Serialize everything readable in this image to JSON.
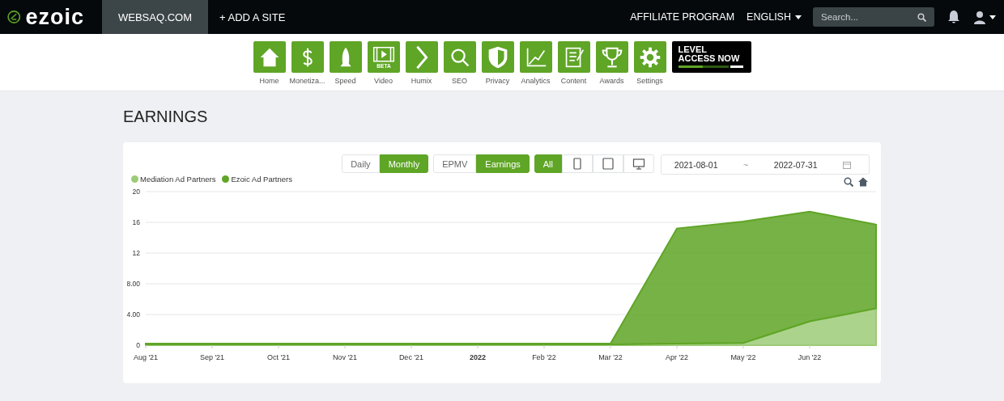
{
  "header": {
    "logo": "ezoic",
    "sites": [
      {
        "label": "WEBSAQ.COM",
        "selected": true
      }
    ],
    "add_site": "+ ADD A SITE",
    "affiliate": "AFFILIATE PROGRAM",
    "language": "ENGLISH",
    "search": {
      "placeholder": "Search..."
    }
  },
  "toolbar": [
    {
      "kind": "home",
      "label": "Home"
    },
    {
      "kind": "dollar",
      "label": "Monetiza..."
    },
    {
      "kind": "rocket",
      "label": "Speed"
    },
    {
      "kind": "video",
      "label": "Video",
      "badge": "BETA"
    },
    {
      "kind": "chevron",
      "label": "Humix"
    },
    {
      "kind": "search",
      "label": "SEO"
    },
    {
      "kind": "shield",
      "label": "Privacy"
    },
    {
      "kind": "analytics",
      "label": "Analytics"
    },
    {
      "kind": "content",
      "label": "Content"
    },
    {
      "kind": "trophy",
      "label": "Awards"
    },
    {
      "kind": "gear",
      "label": "Settings"
    }
  ],
  "banner": {
    "lines": [
      "LEVEL",
      "ACCESS NOW"
    ]
  },
  "page_title": "EARNINGS",
  "period_toggle": [
    {
      "label": "Daily",
      "selected": false
    },
    {
      "label": "Monthly",
      "selected": true
    }
  ],
  "metric_toggle": [
    {
      "label": "EPMV",
      "selected": false
    },
    {
      "label": "Earnings",
      "selected": true
    }
  ],
  "device_filter": [
    {
      "kind": "text",
      "label": "All",
      "selected": true
    },
    {
      "kind": "phone",
      "selected": false
    },
    {
      "kind": "tablet",
      "selected": false
    },
    {
      "kind": "desktop",
      "selected": false
    }
  ],
  "date_range": {
    "start": "2021-08-01",
    "separator": "~",
    "end": "2022-07-31"
  },
  "chart_data": {
    "type": "area",
    "stacked": true,
    "categories": [
      "Aug '21",
      "Sep '21",
      "Oct '21",
      "Nov '21",
      "Dec '21",
      "2022",
      "Feb '22",
      "Mar '22",
      "Apr '22",
      "May '22",
      "Jun '22",
      null
    ],
    "grid": true,
    "series": [
      {
        "name": "Mediation Ad Partners",
        "color": "#9dcb78",
        "values": [
          0.1,
          0.1,
          0.1,
          0.1,
          0.1,
          0.1,
          0.1,
          0.1,
          0.2,
          0.3,
          3.1,
          4.8
        ]
      },
      {
        "name": "Ezoic Ad Partners",
        "color": "#5fa526",
        "values": [
          0.1,
          0.1,
          0.1,
          0.1,
          0.1,
          0.1,
          0.1,
          0.1,
          15.0,
          15.8,
          14.3,
          10.9
        ]
      }
    ],
    "ylim": [
      0,
      20
    ],
    "yticks": [
      0,
      {
        "value": 4,
        "label": "4.00"
      },
      {
        "value": 8,
        "label": "8.00"
      },
      12,
      16,
      20
    ]
  }
}
